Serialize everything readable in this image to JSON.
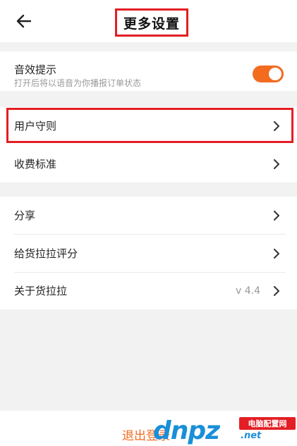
{
  "header": {
    "title": "更多设置",
    "back_icon": "arrow-left-icon"
  },
  "sound": {
    "title": "音效提示",
    "subtitle": "打开后将以语音为你播报订单状态",
    "toggle_on": true,
    "accent": "#f26b1f"
  },
  "group1": {
    "items": [
      {
        "label": "用户守则"
      },
      {
        "label": "收费标准"
      }
    ]
  },
  "group2": {
    "items": [
      {
        "label": "分享"
      },
      {
        "label": "给货拉拉评分"
      },
      {
        "label": "关于货拉拉",
        "value": "v 4.4"
      }
    ]
  },
  "footer": {
    "logout_label": "退出登录"
  },
  "watermark": {
    "logo": "dnpz",
    "badge": "电脑配置网",
    "url": ".net"
  },
  "colors": {
    "highlight": "#e31e24",
    "accent": "#f26b1f",
    "background": "#f2f2f2"
  }
}
